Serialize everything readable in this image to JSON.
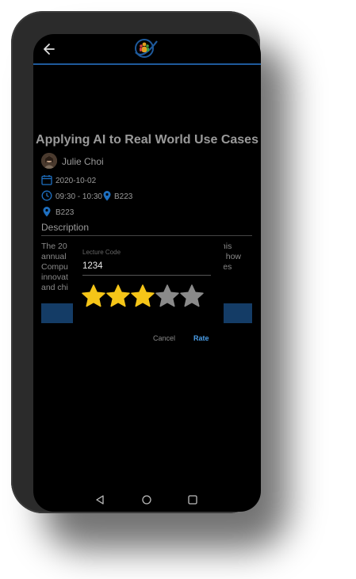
{
  "event": {
    "title": "Applying AI to Real World Use Cases",
    "speaker": "Julie Choi",
    "date": "2020-10-02",
    "time": "09:30 - 10:30",
    "room_inline": "B223",
    "room": "B223",
    "description_heading": "Description",
    "description_left": [
      "The 20",
      "annual",
      "Compu",
      "innovat",
      "and chi"
    ],
    "description_right": [
      "this",
      "",
      "d how",
      "ses",
      ""
    ]
  },
  "dialog": {
    "field_label": "Lecture Code",
    "field_value": "1234",
    "rating": 3,
    "max_rating": 5,
    "cancel_label": "Cancel",
    "rate_label": "Rate"
  },
  "colors": {
    "accent": "#4a9ee8",
    "star_filled": "#f5c518",
    "star_empty": "#8a8a8a",
    "header_rule": "#1e5a9c"
  },
  "icons": {
    "back": "arrow-left-icon",
    "calendar": "calendar-icon",
    "clock": "clock-icon",
    "location": "location-pin-icon"
  }
}
